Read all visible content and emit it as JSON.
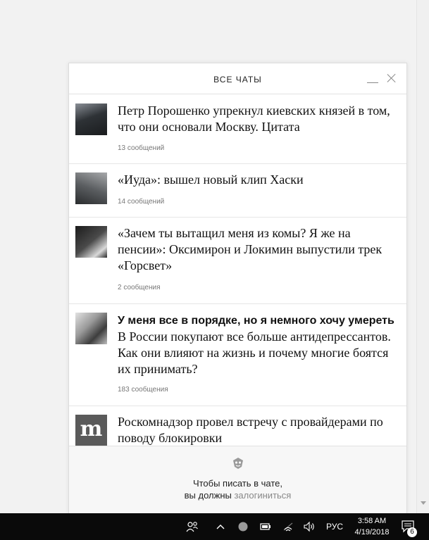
{
  "panel": {
    "title": "ВСЕ ЧАТЫ"
  },
  "chats": [
    {
      "title": "Петр Порошенко упрекнул киевских князей в том, что они основали Москву. Цитата",
      "count": "13 сообщений"
    },
    {
      "title": "«Иуда»: вышел новый клип Хаски",
      "count": "14 сообщений"
    },
    {
      "title": "«Зачем ты вытащил меня из комы? Я же на пенсии»: Оксимирон и Локимин выпустили трек «Горсвет»",
      "count": "2 сообщения"
    },
    {
      "bold": "У меня все в порядке, но я немного хочу умереть",
      "title": "В России покупают все больше антидепрессантов. Как они влияют на жизнь и почему многие боятся их принимать?",
      "count": "183 сообщения"
    },
    {
      "title": "Роскомнадзор провел встречу с провайдерами по поводу блокировки",
      "logo": "m"
    }
  ],
  "login": {
    "line1": "Чтобы писать в чате,",
    "line2_prefix": "вы должны",
    "link": "залогиниться"
  },
  "taskbar": {
    "language": "РУС",
    "time": "3:58 AM",
    "date": "4/19/2018",
    "notification_count": "6"
  }
}
